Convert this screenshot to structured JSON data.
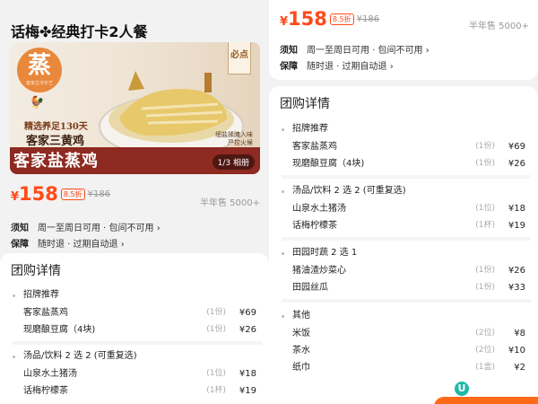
{
  "left": {
    "product": {
      "title": "话梅✤经典打卡2人餐",
      "image": {
        "badge_char": "蒸",
        "badge_sub": "客家古法手艺",
        "slogan_line1": "精选养足130天",
        "slogan_line2": "客家三黄鸡",
        "dish_name": "客家盐蒸鸡",
        "must_label": "必点",
        "tag_line1": "细盐揉腌入味",
        "tag_line2": "严控火候",
        "album_label": "1/3 相册"
      },
      "price_symbol": "¥",
      "price": "158",
      "discount": "8.5折",
      "original_price": "¥186",
      "sold": "半年售 5000+"
    },
    "info": {
      "notice_key": "须知",
      "notice_val": "周一至周日可用 · 包间不可用 ›",
      "guarantee_key": "保障",
      "guarantee_val": "随时退 · 过期自动退 ›"
    },
    "details": {
      "title": "团购详情",
      "groups": [
        {
          "heading": "招牌推荐",
          "items": [
            {
              "name": "客家盐蒸鸡",
              "qty": "(1份)",
              "price": "¥69"
            },
            {
              "name": "现磨酿豆腐（4块)",
              "qty": "(1份)",
              "price": "¥26"
            }
          ]
        },
        {
          "heading": "汤品/饮料 2 选 2 (可重复选)",
          "items": [
            {
              "name": "山泉水土猪汤",
              "qty": "(1位)",
              "price": "¥18"
            },
            {
              "name": "话梅柠檬茶",
              "qty": "(1杯)",
              "price": "¥19"
            }
          ]
        }
      ]
    }
  },
  "right": {
    "price_symbol": "¥",
    "price": "158",
    "discount": "8.5折",
    "original_price": "¥186",
    "sold": "半年售 5000+",
    "info": {
      "notice_key": "须知",
      "notice_val": "周一至周日可用 · 包间不可用 ›",
      "guarantee_key": "保障",
      "guarantee_val": "随时退 · 过期自动退 ›"
    },
    "details": {
      "title": "团购详情",
      "groups": [
        {
          "heading": "招牌推荐",
          "items": [
            {
              "name": "客家盐蒸鸡",
              "qty": "(1份)",
              "price": "¥69"
            },
            {
              "name": "现磨酿豆腐（4块)",
              "qty": "(1份)",
              "price": "¥26"
            }
          ]
        },
        {
          "heading": "汤品/饮料 2 选 2 (可重复选)",
          "items": [
            {
              "name": "山泉水土猪汤",
              "qty": "(1位)",
              "price": "¥18"
            },
            {
              "name": "话梅柠檬茶",
              "qty": "(1杯)",
              "price": "¥19"
            }
          ]
        },
        {
          "heading": "田园时蔬 2 选 1",
          "items": [
            {
              "name": "猪油渣炒菜心",
              "qty": "(1份)",
              "price": "¥26"
            },
            {
              "name": "田园丝瓜",
              "qty": "(1份)",
              "price": "¥33"
            }
          ]
        },
        {
          "heading": "其他",
          "items": [
            {
              "name": "米饭",
              "qty": "(2位)",
              "price": "¥8"
            },
            {
              "name": "茶水",
              "qty": "(2位)",
              "price": "¥10"
            },
            {
              "name": "纸巾",
              "qty": "(1盒)",
              "price": "¥2"
            }
          ]
        }
      ]
    }
  },
  "colors": {
    "accent": "#ff4a1a",
    "page_bg": "#f2f2f2",
    "card_bg": "#ffffff"
  }
}
